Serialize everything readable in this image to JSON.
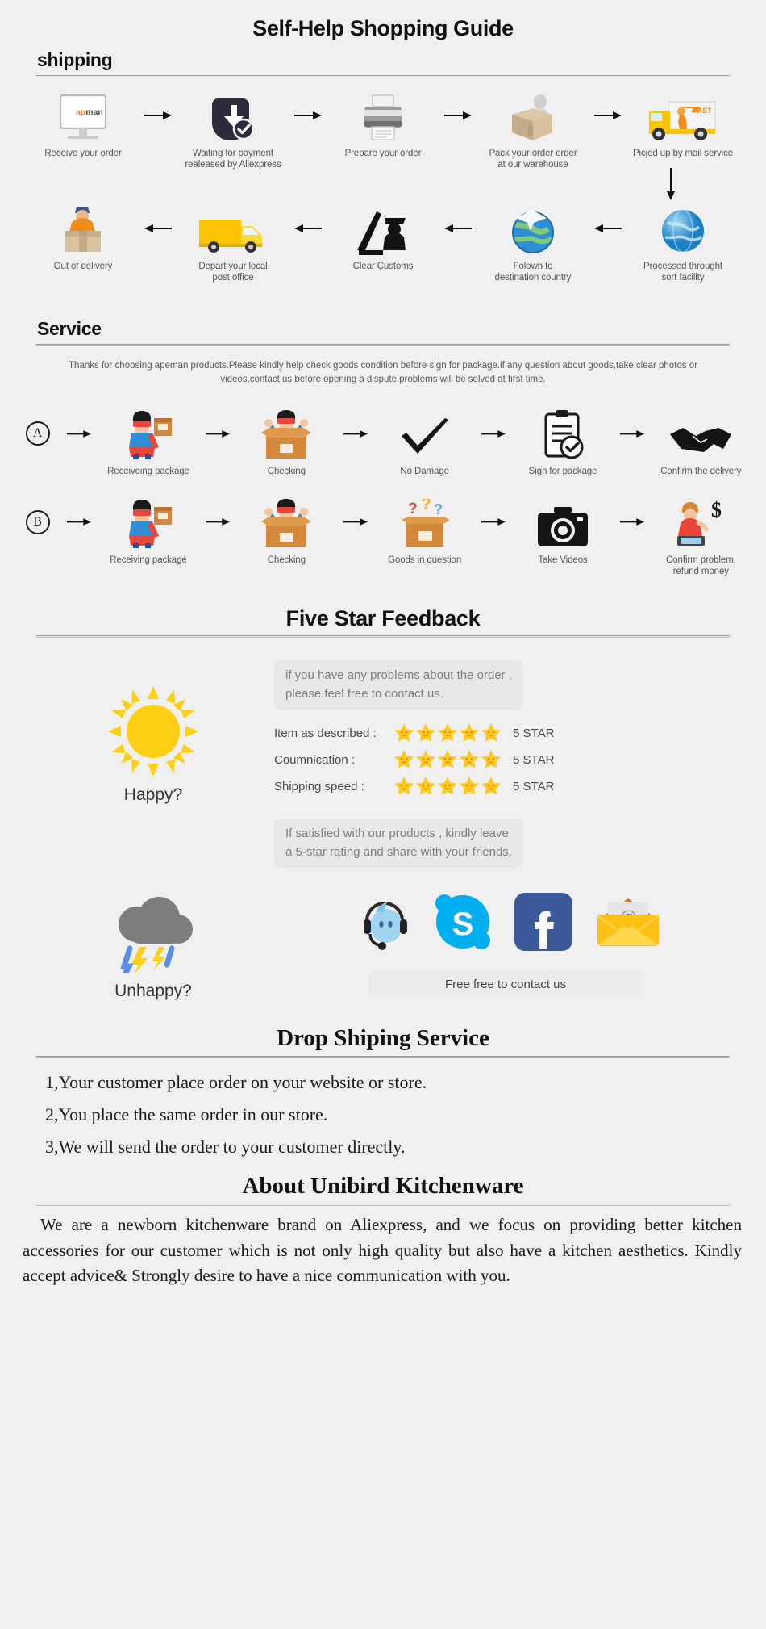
{
  "title": "Self-Help Shopping Guide",
  "sections": {
    "shipping": {
      "heading": "shipping",
      "row1": [
        {
          "label": "Receive your order",
          "icon": "monitor-apeman-icon"
        },
        {
          "label": "Waiting for payment\nrealeased by Aliexpress",
          "icon": "payment-shield-icon"
        },
        {
          "label": "Prepare your order",
          "icon": "printer-icon"
        },
        {
          "label": "Pack your order order\nat our warehouse",
          "icon": "packing-box-icon"
        },
        {
          "label": "Picjed up by mail service",
          "icon": "delivery-truck-icon"
        }
      ],
      "row2": [
        {
          "label": "Out of delivery",
          "icon": "courier-box-icon"
        },
        {
          "label": "Depart your local\npost office",
          "icon": "yellow-van-icon"
        },
        {
          "label": "Clear Customs",
          "icon": "customs-officer-icon"
        },
        {
          "label": "Folown to\ndestination country",
          "icon": "globe-plane-icon"
        },
        {
          "label": "Processed throught\nsort facility",
          "icon": "blue-globe-icon"
        }
      ]
    },
    "service": {
      "heading": "Service",
      "note": "Thanks for choosing apeman products.Please kindly help check goods condition before sign for package.if any question about goods,take clear photos or videos,contact us before opening a dispute,problems will be solved at first time.",
      "rowA": {
        "badge": "A",
        "steps": [
          {
            "label": "Receiveing package",
            "icon": "hero-package-icon"
          },
          {
            "label": "Checking",
            "icon": "hero-in-box-icon"
          },
          {
            "label": "No Damage",
            "icon": "checkmark-icon"
          },
          {
            "label": "Sign for package",
            "icon": "clipboard-sign-icon"
          },
          {
            "label": "Confirm the delivery",
            "icon": "handshake-icon"
          }
        ]
      },
      "rowB": {
        "badge": "B",
        "steps": [
          {
            "label": "Receiving package",
            "icon": "hero-package-icon"
          },
          {
            "label": "Checking",
            "icon": "hero-in-box-icon"
          },
          {
            "label": "Goods in question",
            "icon": "question-box-icon"
          },
          {
            "label": "Take Videos",
            "icon": "camera-icon"
          },
          {
            "label": "Confirm problem,\nrefund money",
            "icon": "refund-person-icon"
          }
        ]
      }
    },
    "feedback": {
      "heading": "Five Star Feedback",
      "happy_label": "Happy?",
      "unhappy_label": "Unhappy?",
      "top_bubble": "if you have any problems about the order ,\nplease feel free to contact us.",
      "bottom_bubble": "If satisfied with our products ,  kindly leave\na 5-star rating and share with your friends.",
      "ratings": [
        {
          "label": "Item as described :",
          "stars": 5,
          "value": "5 STAR"
        },
        {
          "label": "Coumnication :",
          "stars": 5,
          "value": "5 STAR"
        },
        {
          "label": "Shipping speed :",
          "stars": 5,
          "value": "5 STAR"
        }
      ],
      "socials": [
        {
          "name": "aliexpress-support-icon"
        },
        {
          "name": "skype-icon"
        },
        {
          "name": "facebook-icon"
        },
        {
          "name": "email-icon"
        }
      ],
      "contact_bar": "Free free to contact us"
    },
    "dropship": {
      "heading": "Drop Shiping Service",
      "items": [
        "1,Your customer place order on your website or store.",
        "2,You place the same order in our store.",
        "3,We will send the order to your customer directly."
      ]
    },
    "about": {
      "heading": "About Unibird Kitchenware",
      "body": "We are a newborn kitchenware brand on Aliexpress, and we focus on providing better kitchen accessories for our customer which is not only high quality but also have a kitchen aesthetics. Kindly accept advice& Strongly desire to have a nice communication with you."
    }
  },
  "colors": {
    "background": "#f0f0f0",
    "star": "#ffc820",
    "skype": "#00aff0",
    "facebook": "#3b5998",
    "envelope": "#fcc013",
    "sun": "#ffd015",
    "cloud": "#7c7c7c"
  }
}
